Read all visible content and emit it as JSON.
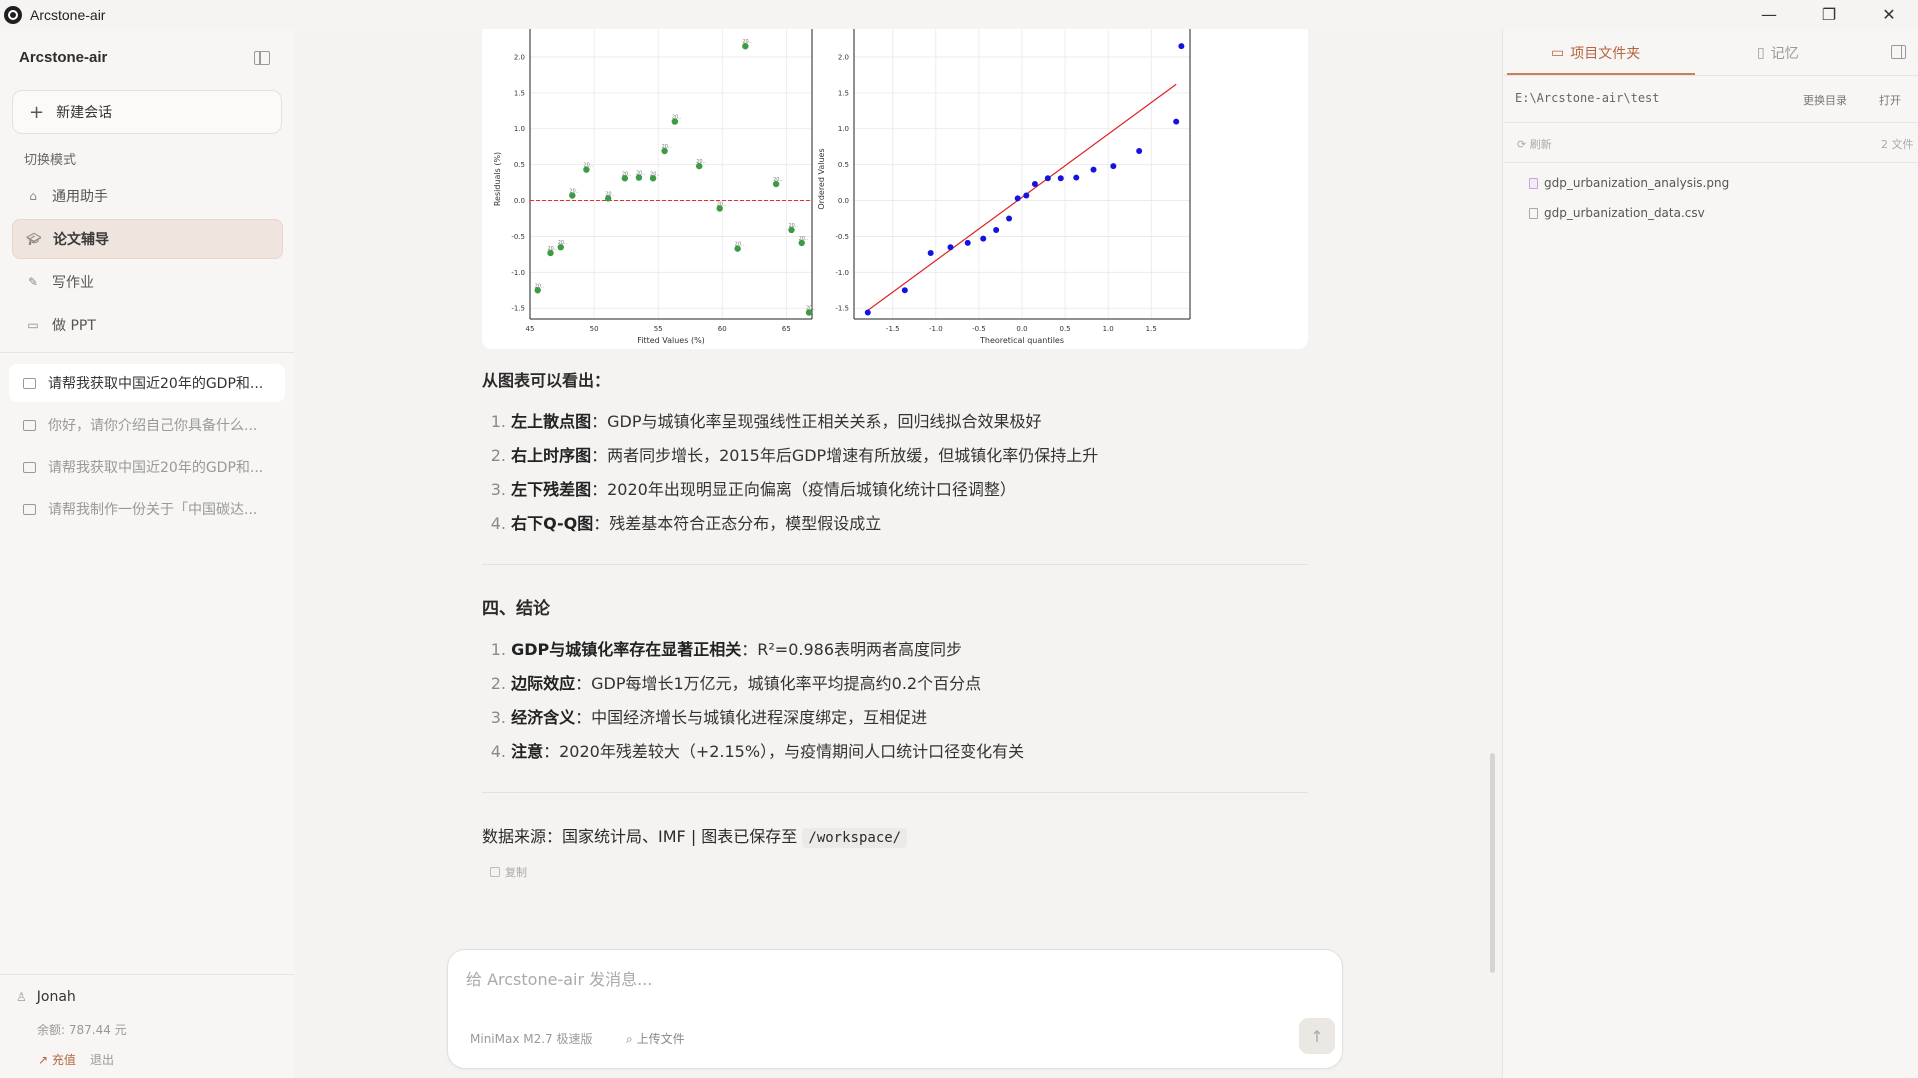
{
  "window": {
    "title": "Arcstone-air",
    "controls": {
      "minimize": "—",
      "maximize": "❐",
      "close": "✕"
    }
  },
  "sidebar": {
    "app_name": "Arcstone-air",
    "new_chat": "新建会话",
    "mode_label": "切换模式",
    "modes": [
      {
        "label": "通用助手",
        "icon": "robot-icon",
        "active": false
      },
      {
        "label": "论文辅导",
        "icon": "graduation-cap-icon",
        "active": true
      },
      {
        "label": "写作业",
        "icon": "pencil-icon",
        "active": false
      },
      {
        "label": "做 PPT",
        "icon": "presentation-icon",
        "active": false
      }
    ],
    "chats": [
      {
        "label": "请帮我获取中国近20年的GDP和...",
        "active": true
      },
      {
        "label": "你好，请你介绍自己你具备什么...",
        "active": false
      },
      {
        "label": "请帮我获取中国近20年的GDP和...",
        "active": false
      },
      {
        "label": "请帮我制作一份关于「中国碳达...",
        "active": false
      }
    ],
    "user": {
      "name": "Jonah",
      "balance": "余额: 787.44 元",
      "recharge": "充值",
      "logout": "退出"
    }
  },
  "message": {
    "observations_title": "从图表可以看出：",
    "observations": [
      {
        "num": "1.",
        "bold": "左上散点图",
        "text": "：GDP与城镇化率呈现强线性正相关关系，回归线拟合效果极好"
      },
      {
        "num": "2.",
        "bold": "右上时序图",
        "text": "：两者同步增长，2015年后GDP增速有所放缓，但城镇化率仍保持上升"
      },
      {
        "num": "3.",
        "bold": "左下残差图",
        "text": "：2020年出现明显正向偏离（疫情后城镇化统计口径调整）"
      },
      {
        "num": "4.",
        "bold": "右下Q-Q图",
        "text": "：残差基本符合正态分布，模型假设成立"
      }
    ],
    "conclusion_title": "四、结论",
    "conclusions": [
      {
        "num": "1.",
        "bold": "GDP与城镇化率存在显著正相关",
        "text": "：R²=0.986表明两者高度同步"
      },
      {
        "num": "2.",
        "bold": "边际效应",
        "text": "：GDP每增长1万亿元，城镇化率平均提高约0.2个百分点"
      },
      {
        "num": "3.",
        "bold": "经济含义",
        "text": "：中国经济增长与城镇化进程深度绑定，互相促进"
      },
      {
        "num": "4.",
        "bold": "注意",
        "text": "：2020年残差较大（+2.15%），与疫情期间人口统计口径变化有关"
      }
    ],
    "source_text": "数据来源：国家统计局、IMF | 图表已保存至 ",
    "source_code": "/workspace/",
    "copy": "复制"
  },
  "input": {
    "placeholder": "给 Arcstone-air 发消息...",
    "model": "MiniMax M2.7 极速版",
    "upload": "上传文件",
    "send_icon": "↑"
  },
  "right_panel": {
    "tab_files": "项目文件夹",
    "tab_memory": "记忆",
    "path": "E:\\Arcstone-air\\test",
    "change_dir": "更换目录",
    "open": "打开",
    "refresh": "刷新",
    "file_count": "2 文件",
    "files": [
      {
        "name": "gdp_urbanization_analysis.png",
        "type": "image"
      },
      {
        "name": "gdp_urbanization_data.csv",
        "type": "csv"
      }
    ]
  },
  "chart_data": [
    {
      "type": "scatter",
      "xlabel": "Fitted Values (%)",
      "ylabel": "Residuals (%)",
      "xlim": [
        45,
        67
      ],
      "ylim": [
        -1.65,
        2.25
      ],
      "xticks": [
        45,
        50,
        55,
        60,
        65
      ],
      "yticks": [
        -1.5,
        -1.0,
        -0.5,
        0.0,
        0.5,
        1.0,
        1.5,
        2.0
      ],
      "reference_line": 0.0,
      "point_label": "20..",
      "points": [
        {
          "x": 45.6,
          "y": -1.25
        },
        {
          "x": 46.6,
          "y": -0.73
        },
        {
          "x": 47.4,
          "y": -0.65
        },
        {
          "x": 48.3,
          "y": 0.07
        },
        {
          "x": 49.4,
          "y": 0.43
        },
        {
          "x": 51.1,
          "y": 0.03
        },
        {
          "x": 52.4,
          "y": 0.31
        },
        {
          "x": 53.5,
          "y": 0.32
        },
        {
          "x": 54.6,
          "y": 0.31
        },
        {
          "x": 55.5,
          "y": 0.69
        },
        {
          "x": 56.3,
          "y": 1.1
        },
        {
          "x": 58.2,
          "y": 0.48
        },
        {
          "x": 59.8,
          "y": -0.11
        },
        {
          "x": 61.2,
          "y": -0.67
        },
        {
          "x": 61.8,
          "y": 2.15
        },
        {
          "x": 64.2,
          "y": 0.23
        },
        {
          "x": 65.4,
          "y": -0.41
        },
        {
          "x": 66.2,
          "y": -0.59
        },
        {
          "x": 68.3,
          "y": -1.56
        }
      ]
    },
    {
      "type": "scatter",
      "xlabel": "Theoretical quantiles",
      "ylabel": "Ordered Values",
      "xlim": [
        -1.95,
        1.95
      ],
      "ylim": [
        -1.65,
        2.25
      ],
      "xticks": [
        -1.5,
        -1.0,
        -0.5,
        0.0,
        0.5,
        1.0,
        1.5
      ],
      "yticks": [
        -1.5,
        -1.0,
        -0.5,
        0.0,
        0.5,
        1.0,
        1.5,
        2.0
      ],
      "fit_line": [
        [
          -1.79,
          -1.53
        ],
        [
          1.79,
          1.62
        ]
      ],
      "points": [
        {
          "x": -1.79,
          "y": -1.56
        },
        {
          "x": -1.36,
          "y": -1.25
        },
        {
          "x": -1.06,
          "y": -0.73
        },
        {
          "x": -0.83,
          "y": -0.65
        },
        {
          "x": -0.63,
          "y": -0.59
        },
        {
          "x": -0.45,
          "y": -0.53
        },
        {
          "x": -0.3,
          "y": -0.41
        },
        {
          "x": -0.15,
          "y": -0.25
        },
        {
          "x": -0.05,
          "y": 0.03
        },
        {
          "x": 0.05,
          "y": 0.07
        },
        {
          "x": 0.15,
          "y": 0.23
        },
        {
          "x": 0.3,
          "y": 0.31
        },
        {
          "x": 0.45,
          "y": 0.31
        },
        {
          "x": 0.63,
          "y": 0.32
        },
        {
          "x": 0.83,
          "y": 0.43
        },
        {
          "x": 1.06,
          "y": 0.48
        },
        {
          "x": 1.36,
          "y": 0.69
        },
        {
          "x": 1.79,
          "y": 1.1
        },
        {
          "x": 1.85,
          "y": 2.15
        }
      ]
    }
  ]
}
